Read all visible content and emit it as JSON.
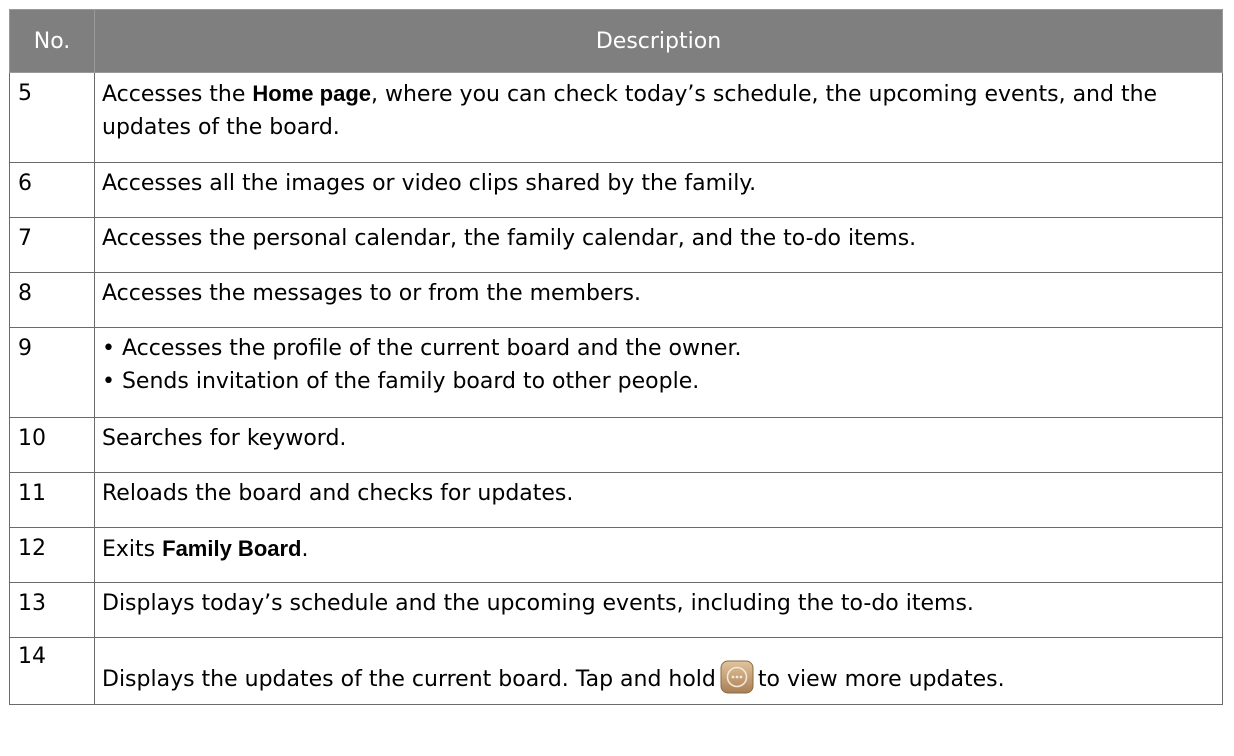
{
  "table": {
    "headers": {
      "no": "No.",
      "description": "Description"
    },
    "rows": [
      {
        "no": "5",
        "desc_part1": "Accesses the ",
        "desc_bold": "Home page",
        "desc_part2": ", where you can check today’s schedule, the upcoming events, and the updates of the board."
      },
      {
        "no": "6",
        "desc": "Accesses all the images or video clips shared by the family."
      },
      {
        "no": "7",
        "desc": "Accesses the personal calendar, the family calendar, and the to-do items."
      },
      {
        "no": "8",
        "desc": "Accesses the messages to or from the members."
      },
      {
        "no": "9",
        "bullet1": "• Accesses the profile of the current board and the owner.",
        "bullet2": "• Sends invitation of the family board to other people."
      },
      {
        "no": "10",
        "desc": "Searches for keyword."
      },
      {
        "no": "11",
        "desc": "Reloads the board and checks for updates."
      },
      {
        "no": "12",
        "desc_part1": "Exits ",
        "desc_bold": "Family Board",
        "desc_part2": "."
      },
      {
        "no": "13",
        "desc": "Displays today’s schedule and the upcoming events, including the to-do items."
      },
      {
        "no": "14",
        "desc_part1": "Displays the updates of the current board. Tap and hold",
        "icon": "more-updates-icon",
        "desc_part2": "to view more updates."
      }
    ]
  },
  "colors": {
    "header_bg": "#7f7f7f",
    "header_text": "#ffffff",
    "border": "#6b6b6b",
    "icon_bg": "#c8a37a"
  }
}
